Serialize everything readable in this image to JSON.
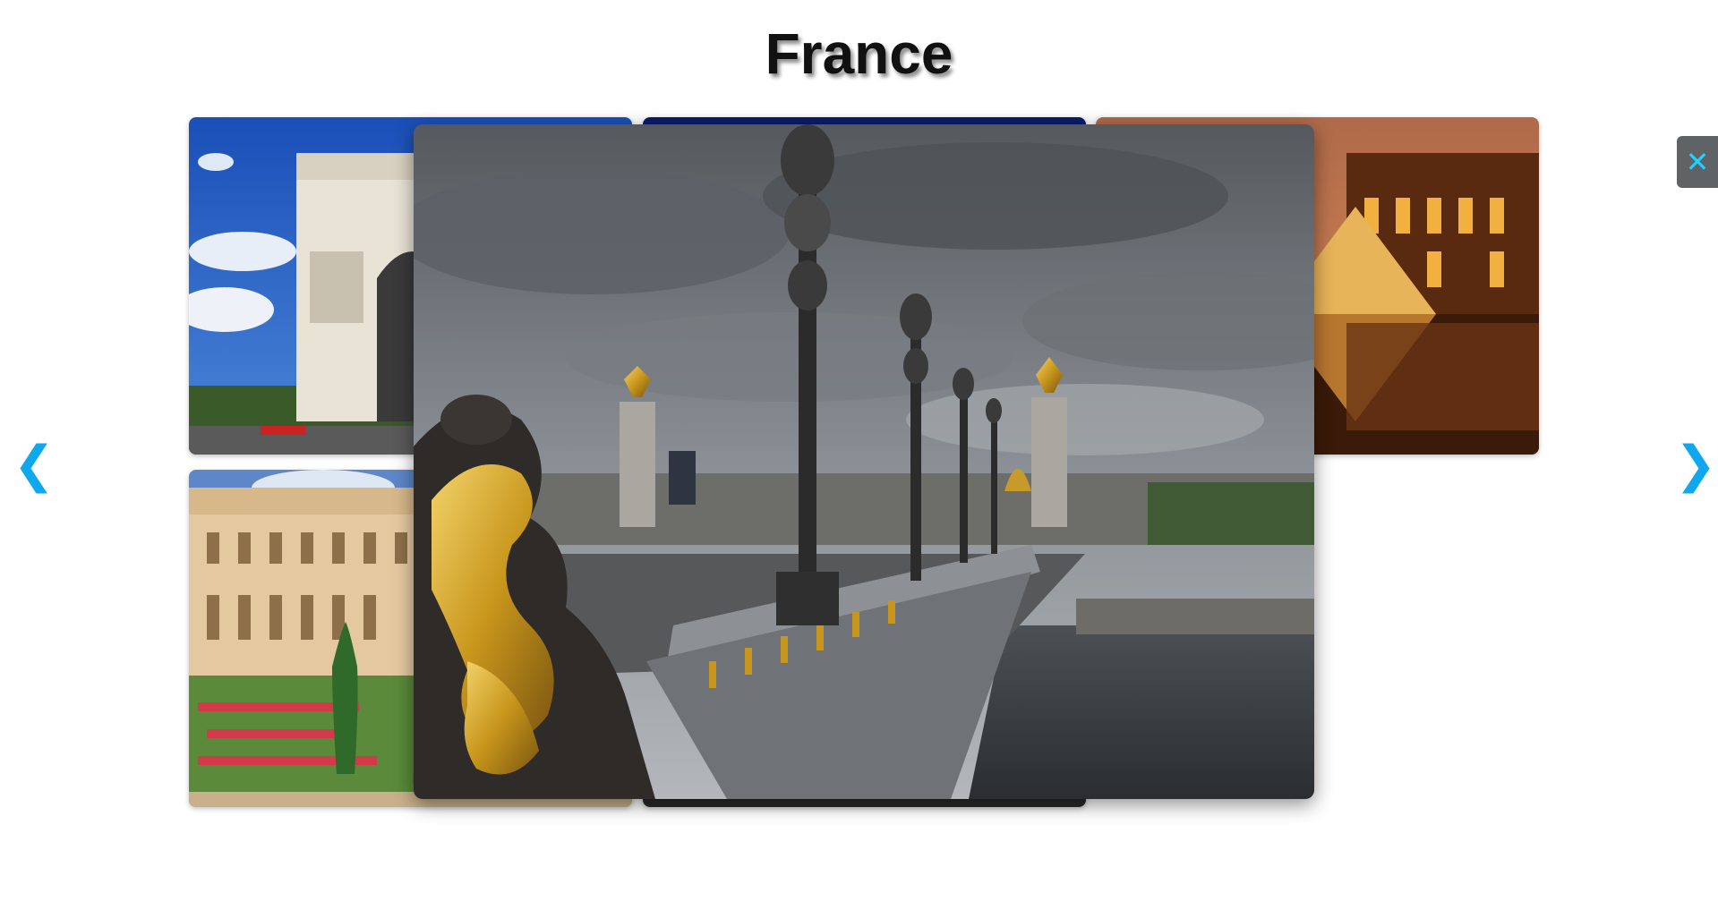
{
  "gallery": {
    "title": "France",
    "thumbnails": [
      {
        "subject": "arc-de-triomphe"
      },
      {
        "subject": "eiffel-tower-night"
      },
      {
        "subject": "louvre-pyramid"
      },
      {
        "subject": "palace-of-versailles"
      },
      {
        "subject": "city-at-night"
      }
    ]
  },
  "lightbox": {
    "image_subject": "pont-alexandre-iii",
    "close_label": "✕",
    "prev_label": "❮",
    "next_label": "❯",
    "accent_color": "#0fa8ee"
  },
  "icons": {
    "close": "close-icon",
    "prev": "chevron-left-icon",
    "next": "chevron-right-icon"
  }
}
